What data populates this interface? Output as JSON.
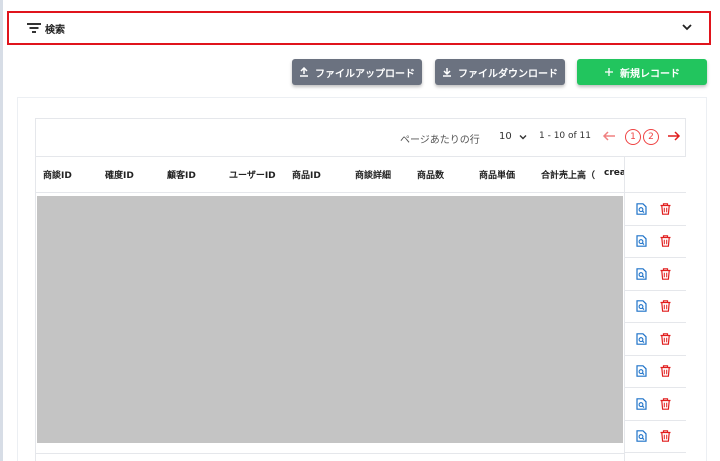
{
  "search": {
    "label": "検索"
  },
  "toolbar": {
    "upload_label": "ファイルアップロード",
    "download_label": "ファイルダウンロード",
    "new_label": "新規レコード"
  },
  "pagination": {
    "rows_per_page_label": "ページあたりの行",
    "rows_per_page_value": "10",
    "range": "1 - 10 of 11",
    "pages": [
      "1",
      "2"
    ]
  },
  "table": {
    "columns": [
      "商談ID",
      "確度ID",
      "顧客ID",
      "ユーザーID",
      "商品ID",
      "商談詳細",
      "商品数",
      "商品単価",
      "合計売上高（",
      "creat"
    ],
    "row_count": 8
  },
  "colors": {
    "search_border": "#e0141c",
    "gray_button": "#6b7280",
    "green_button": "#22c55e",
    "view_icon": "#1d72c9",
    "delete_icon": "#e11d1d",
    "pagination_accent": "#ef4444"
  },
  "icons": {
    "search": "filter-icon",
    "expand": "chevron-down-icon",
    "upload": "upload-icon",
    "download": "download-icon",
    "new": "plus-icon",
    "view": "document-search-icon",
    "delete": "trash-icon"
  }
}
